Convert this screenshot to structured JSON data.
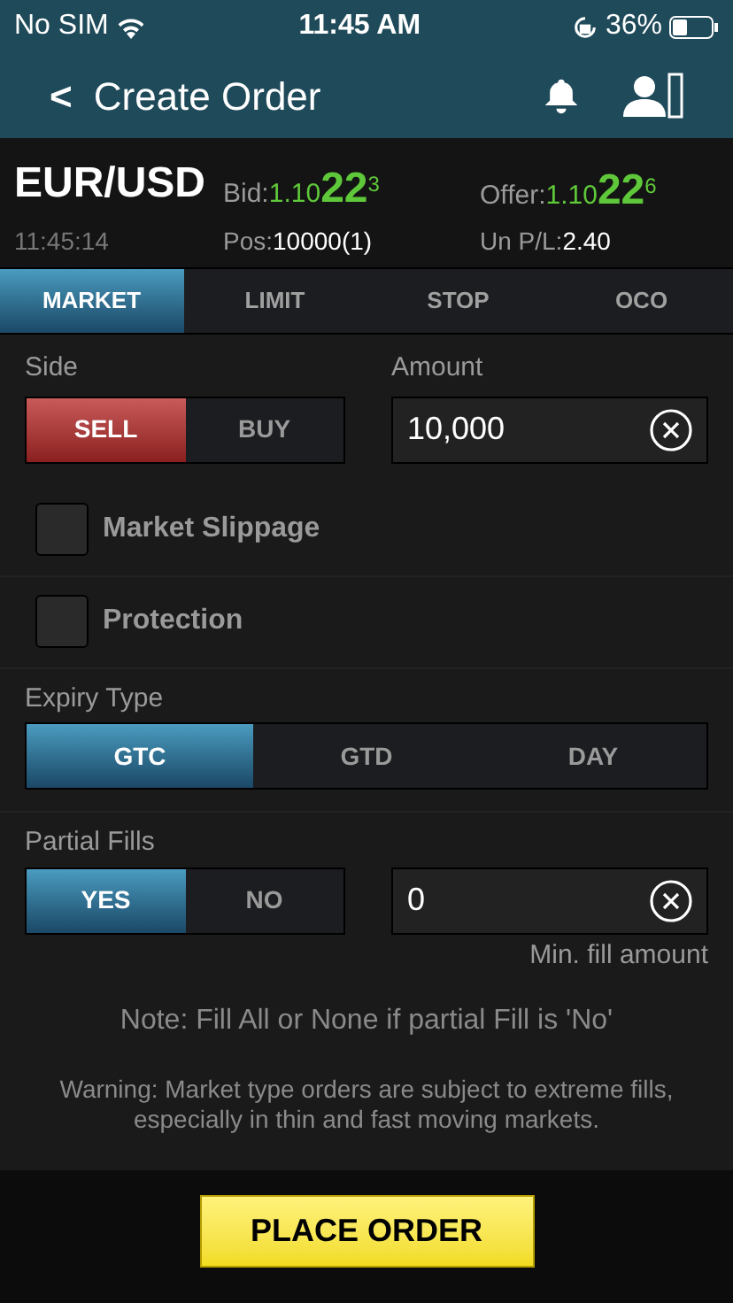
{
  "status_bar": {
    "carrier": "No SIM",
    "time": "11:45 AM",
    "battery": "36%"
  },
  "header": {
    "back": "<",
    "title": "Create Order"
  },
  "quote": {
    "symbol": "EUR/USD",
    "time": "11:45:14",
    "bid": {
      "label": "Bid:",
      "base": "1.10",
      "big": "22",
      "pip": "3"
    },
    "offer": {
      "label": "Offer:",
      "base": "1.10",
      "big": "22",
      "pip": "6"
    },
    "position": {
      "label": "Pos:",
      "value": "10000(1)"
    },
    "pnl": {
      "label": "Un P/L:",
      "value": "2.40"
    }
  },
  "order_tabs": [
    {
      "label": "MARKET",
      "selected": true
    },
    {
      "label": "LIMIT",
      "selected": false
    },
    {
      "label": "STOP",
      "selected": false
    },
    {
      "label": "OCO",
      "selected": false
    }
  ],
  "side": {
    "label": "Side",
    "options": [
      {
        "label": "SELL",
        "selected": true
      },
      {
        "label": "BUY",
        "selected": false
      }
    ]
  },
  "amount": {
    "label": "Amount",
    "value": "10,000"
  },
  "checkboxes": [
    {
      "label": "Market Slippage",
      "checked": false
    },
    {
      "label": "Protection",
      "checked": false
    }
  ],
  "expiry": {
    "label": "Expiry Type",
    "options": [
      {
        "label": "GTC",
        "selected": true
      },
      {
        "label": "GTD",
        "selected": false
      },
      {
        "label": "DAY",
        "selected": false
      }
    ]
  },
  "partial_fills": {
    "label": "Partial Fills",
    "options": [
      {
        "label": "YES",
        "selected": true
      },
      {
        "label": "NO",
        "selected": false
      }
    ],
    "min_fill": {
      "value": "0",
      "caption": "Min. fill amount"
    }
  },
  "note": "Note: Fill All or None if partial Fill is 'No'",
  "warning": "Warning: Market type orders are subject to extreme fills, especially in thin and fast moving markets.",
  "place_order": "PLACE ORDER"
}
